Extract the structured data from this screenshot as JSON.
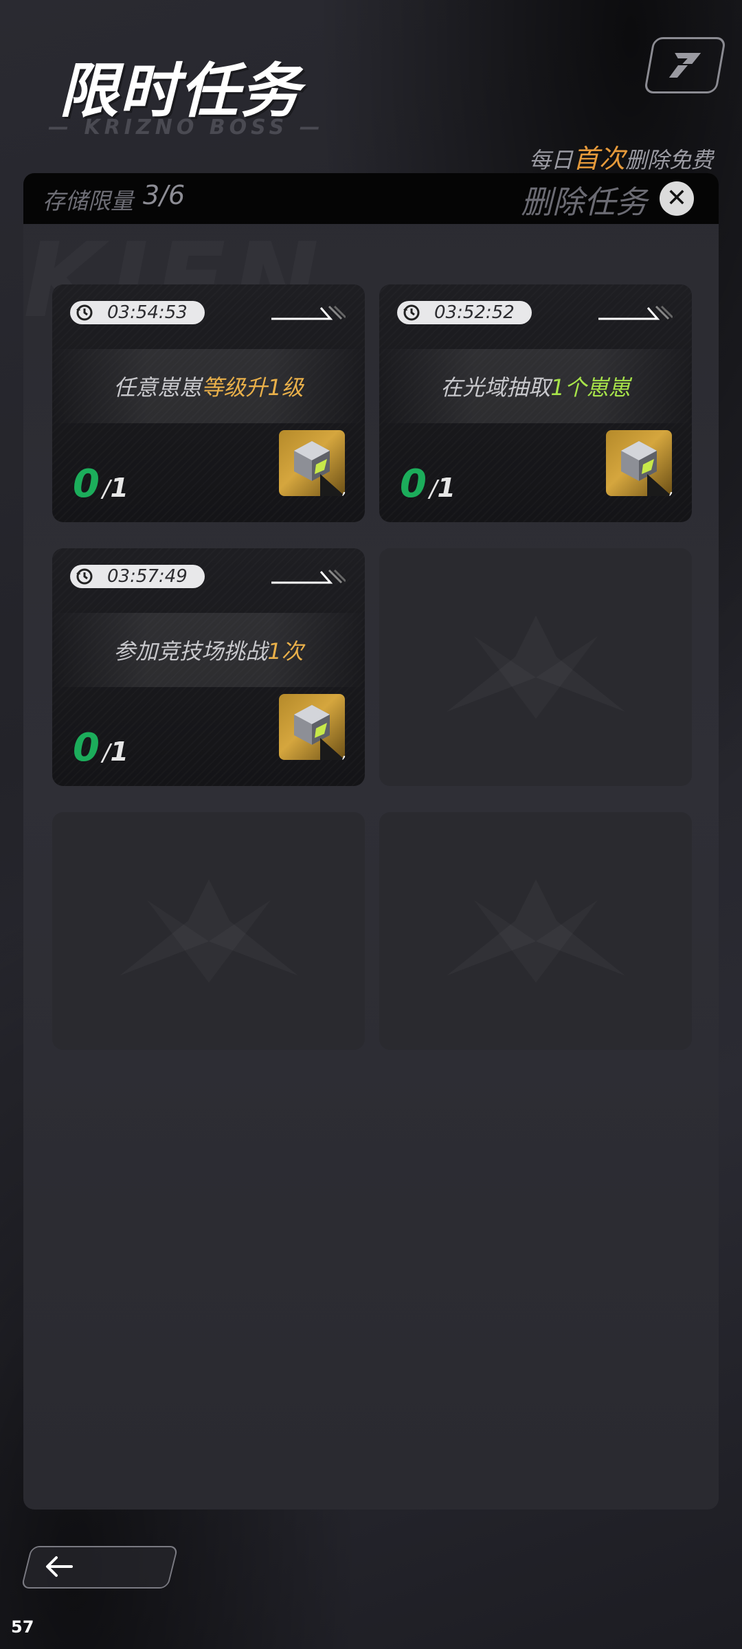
{
  "header": {
    "title": "限时任务",
    "subtitle": "— KRIZNO BOSS —",
    "free_note_prefix": "每日",
    "free_note_highlight": "首次",
    "free_note_suffix": "删除免费",
    "logo_icon": "game-logo-icon"
  },
  "storage": {
    "label": "存储限量",
    "value": "3/6"
  },
  "delete": {
    "label": "删除任务",
    "icon": "close-icon"
  },
  "tasks": [
    {
      "timer": "03:54:53",
      "text_plain": "任意崽崽",
      "text_highlight": "等级升1级",
      "highlight_color": "gold",
      "progress_current": "0",
      "progress_sep": "/",
      "progress_total": "1",
      "reward_icon": "cube-reward-icon",
      "reward_count": ","
    },
    {
      "timer": "03:52:52",
      "text_plain": "在光域抽取",
      "text_highlight": "1个崽崽",
      "highlight_color": "green",
      "progress_current": "0",
      "progress_sep": "/",
      "progress_total": "1",
      "reward_icon": "cube-reward-icon",
      "reward_count": ","
    },
    {
      "timer": "03:57:49",
      "text_plain": "参加竞技场挑战",
      "text_highlight": "1次",
      "highlight_color": "gold",
      "progress_current": "0",
      "progress_sep": "/",
      "progress_total": "1",
      "reward_icon": "cube-reward-icon",
      "reward_count": ","
    }
  ],
  "empty_slots": 3,
  "footer": {
    "back_icon": "arrow-left-icon",
    "fps": "57"
  },
  "colors": {
    "accent_orange": "#e69a3b",
    "highlight_gold": "#e9b04a",
    "highlight_green": "#a7e34a",
    "progress_green": "#1cad5b"
  }
}
